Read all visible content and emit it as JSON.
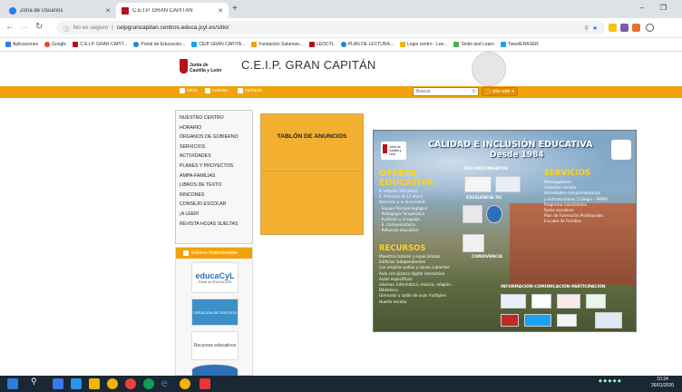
{
  "browser": {
    "tabs": [
      {
        "title": "Zona de Usuarios",
        "fav_color": "#2a7de1"
      },
      {
        "title": "C.E.I.P. GRAN CAPITÁN",
        "fav_color": "#b5121b"
      }
    ],
    "new_tab": "+",
    "window_controls": {
      "minimize": "–",
      "restore": "❐"
    },
    "address": {
      "security": "No es seguro",
      "url": "ceipgrancapitan.centros.educa.jcyl.es/sitio/"
    },
    "bookmarks": [
      "Aplicaciones",
      "Google",
      "C.E.I.P. GRAN CAPIT...",
      "Portal de Educación...",
      "CEIP GRAN CAPITÁ...",
      "Fundación Salaman...",
      "LEOCYL",
      "PLAN DE LECTURA...",
      "Login centro - Lee...",
      "Smile and Learn",
      "TweetERASER"
    ]
  },
  "header": {
    "logo_line1": "Junta de",
    "logo_line2": "Castilla y León",
    "site_title": "C.E.I.P. GRAN CAPITÁN"
  },
  "topnav": {
    "inicio": "inicio",
    "noticias": "noticias",
    "contacto": "contacto",
    "search_placeholder": "Buscar",
    "sitio_web": "sitio web"
  },
  "sidebar": {
    "items": [
      "NUESTRO CENTRO",
      "HORARIO",
      "ÓRGANOS DE GOBIERNO",
      "SERVICIOS",
      "ACTIVIDADES",
      "PLANES Y PROYECTOS",
      "AMPA-FAMILIAS",
      "LIBROS DE TEXTO",
      "RINCONES",
      "CONSEJO ESCOLAR",
      "¡A LEER!",
      "REVISTA HOJAS SUELTAS"
    ]
  },
  "enlaces": {
    "header": "Enlaces Institucionales",
    "educa_title": "educaCyL",
    "educa_sub": "Portal de EDUCACIÓN",
    "crea_label": "CREACIÓN DE CENTROS",
    "recursos_label": "Recursos educativos"
  },
  "tablon": {
    "title": "TABLÓN DE ANUNCIOS"
  },
  "poster": {
    "title": "CALIDAD E INCLUSIÓN EDUCATIVA",
    "desde": "Desde 1984",
    "logo_line1": "Junta de",
    "logo_line2": "Castilla y León",
    "oferta_title": "OFERTA EDUCATIVA",
    "oferta_items": [
      "E. Infantil (3-6 años)",
      "E. Primaria (6-12 años)",
      "Atención a la diversidad:",
      "· Equipo Psicopedagógico",
      "· Pedagogía Terapéutica",
      "· Audición y Lenguaje",
      "· E. Compensatoria",
      "· Refuerzo educativo"
    ],
    "reconocimientos": "RECONOCIMIENTOS",
    "excelencia": "EXCELENCIA TIC",
    "convivencia": "CONVIVENCIA",
    "servicios_title": "SERVICIOS",
    "servicios_items": [
      "Madrugadores",
      "Comedor escolar",
      "Actividades complementarias",
      "y extraescolares (Colegio - AMPA)",
      "Programa Conciliamos",
      "Rutas escolares",
      "Plan de Formación Profesorado",
      "Escuela de Familias"
    ],
    "recursos_title": "RECURSOS",
    "recursos_items": [
      "Maestros tutores y especialistas",
      "Edificios independientes",
      "con amplios patios y zonas cubiertas",
      "Aula con pizarra digital interactiva",
      "Aulas específicas:",
      "idiomas, informática, música, religión...",
      "Biblioteca",
      "Gimnasio y salón de usos múltiples",
      "Huerto escolar"
    ],
    "info": "INFORMACIÓN-COMUNICACIÓN-PARTICIPACIÓN"
  },
  "taskbar": {
    "time": "10:24",
    "date": "26/01/2020"
  }
}
